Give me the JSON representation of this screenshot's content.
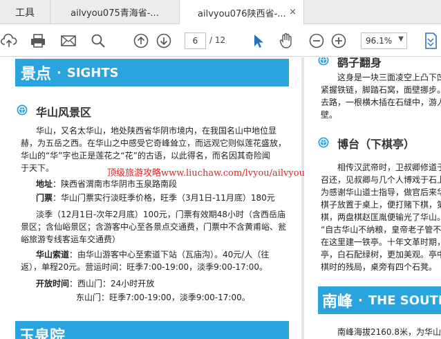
{
  "tabs": {
    "tools": "工具",
    "tab1": "ailvyou075青海省-...",
    "tab2": "ailvyou076陕西省-...",
    "close": "×"
  },
  "toolbar": {
    "page_current": "6",
    "page_total": "/ 12",
    "zoom": "96.1%"
  },
  "left": {
    "banner_cn": "景点",
    "banner_dot": "·",
    "banner_en": "SIGHTS",
    "heading": "华山风景区",
    "p1": [
      "华山，又名太华山，地处陕西省华阴市境内，在我国名山中地位显",
      "赫，为五岳之西。在华山之中感受它奇峰耸立，而远观它则似莲花盛放，",
      "华山的“华”字也正是莲花之“花”的古语，以此得名，而名因其奇险闻",
      "于天下。"
    ],
    "address_label": "地址",
    "address": "：陕西省渭南市华阴市玉泉路南段",
    "ticket_label": "门票",
    "ticket": "：华山门票实行淡旺季价格，旺季（3月1日-11月底）180元",
    "ticket2": [
      "淡季（12月1日-次年2月底）100元，门票有效期48小时（含西岳庙",
      "景区；含仙峪景区；含游客中心至各景点交通费，门票中不含黄甫峪、瓮",
      "峪旅游专线客运车交通费）"
    ],
    "cable_label": "华山索道",
    "cable": [
      "：由华山游客中心至索道下站（瓦庙沟）。40元/人（往",
      "返），单程20元。营运时间：旺季7:00-19:00，淡季9:00-17:00。"
    ],
    "open_label": "开放时间",
    "open1": "：西山门：24小时开放",
    "open2": "东山门：旺季7:00-19:00，淡季9:00-17:00。",
    "next_banner": "玉泉院"
  },
  "right": {
    "heading1": "鹞子翻身",
    "p1": [
      "这身是一块三面凌空上凸下凹",
      "紧握铁链，脚踏石窝，面壁挪步。",
      "去路，一根横木插在石缝中，游人",
      "壁。"
    ],
    "heading2": "博台（下棋亭）",
    "p2": [
      "相传汉武帝时，卫叔卿修道于",
      "召还，见叔卿与几个人博戏于石上",
      "为感谢华山道士指导，做官后来华",
      "棋子放置于桌上，便打赌下棋，第",
      "棋，两盘棋赵匡胤便输光了华山。",
      "“自古华山不纳粮，皇帝老子管不",
      "在这里建一铁亭。十年文革时期，",
      "亭，白石配绿树，更加美观。亭中",
      "棋时的残局，桌旁有四个石凳。"
    ],
    "banner_cn": "南峰",
    "banner_dot": "·",
    "banner_en": "THE SOUTH",
    "p3": "南峰海拔2160.8米，为华山最"
  },
  "watermark": "顶级旅游攻略www.liuchaw.com/lvyou/ailvyou",
  "colors": {
    "banner": "#29a4df",
    "watermark": "#e62020",
    "select_tool": "#2b6fc2"
  }
}
